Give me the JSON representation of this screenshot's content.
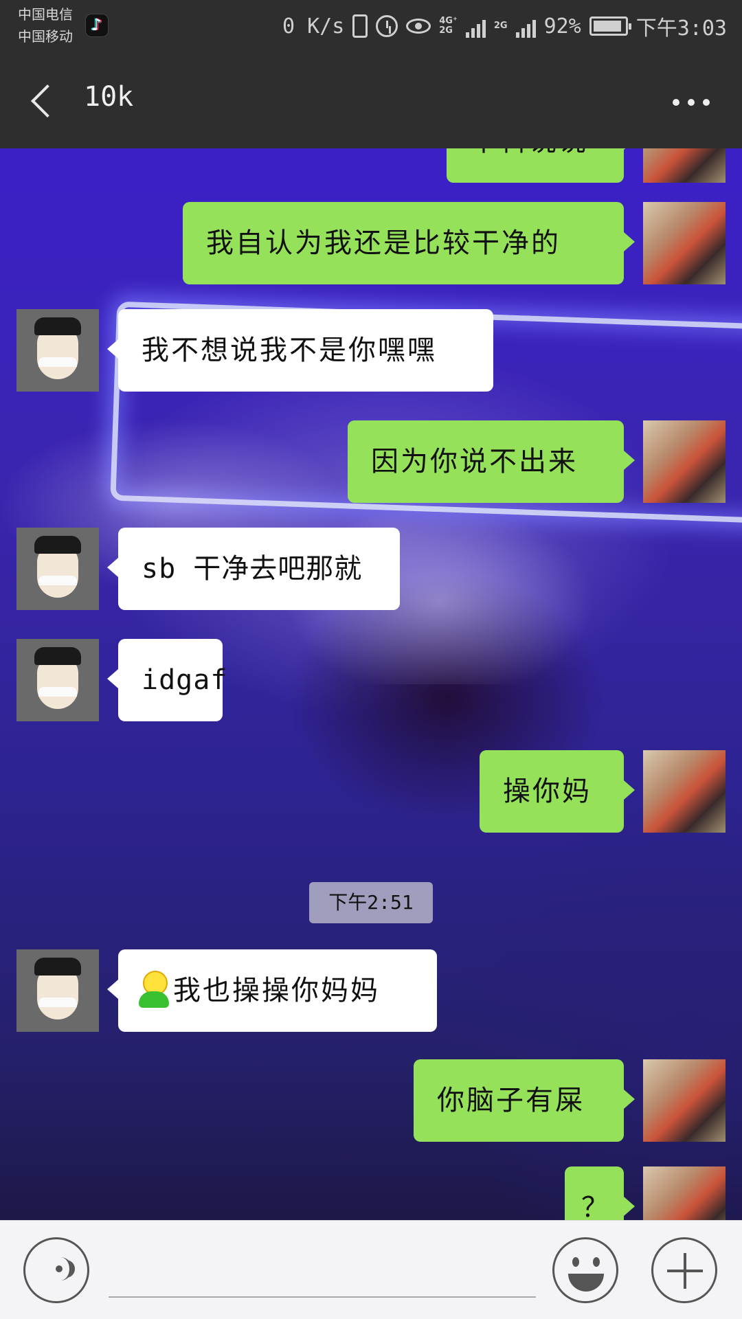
{
  "status_bar": {
    "carrier_1": "中国电信",
    "carrier_2": "中国移动",
    "net_speed": "0 K/s",
    "net_4g": "4G⁺",
    "net_2g_a": "2G",
    "net_2g_b": "2G",
    "battery": "92%",
    "time": "下午3:03"
  },
  "header": {
    "title": "10k",
    "back_icon": "chevron-left-icon",
    "more_icon": "more-dots-icon"
  },
  "messages": [
    {
      "side": "me",
      "text": "本科说说"
    },
    {
      "side": "me",
      "text": "我自认为我还是比较干净的"
    },
    {
      "side": "them",
      "text": "我不想说我不是你嘿嘿"
    },
    {
      "side": "me",
      "text": "因为你说不出来"
    },
    {
      "side": "them",
      "text": "sb 干净去吧那就"
    },
    {
      "side": "them",
      "text": "idgaf"
    },
    {
      "side": "me",
      "text": "操你妈"
    },
    {
      "side": "them",
      "text": "我也操操你妈妈",
      "emoji": "bald-man-emoji"
    },
    {
      "side": "me",
      "text": "你脑子有屎"
    },
    {
      "side": "me",
      "text": "？"
    }
  ],
  "timestamp": "下午2:51",
  "input_bar": {
    "voice_icon": "voice-icon",
    "emoji_icon": "smiley-icon",
    "plus_icon": "plus-icon",
    "placeholder": ""
  },
  "colors": {
    "my_bubble": "#95e25a",
    "their_bubble": "#ffffff",
    "header_bg": "#2e2e2e"
  }
}
